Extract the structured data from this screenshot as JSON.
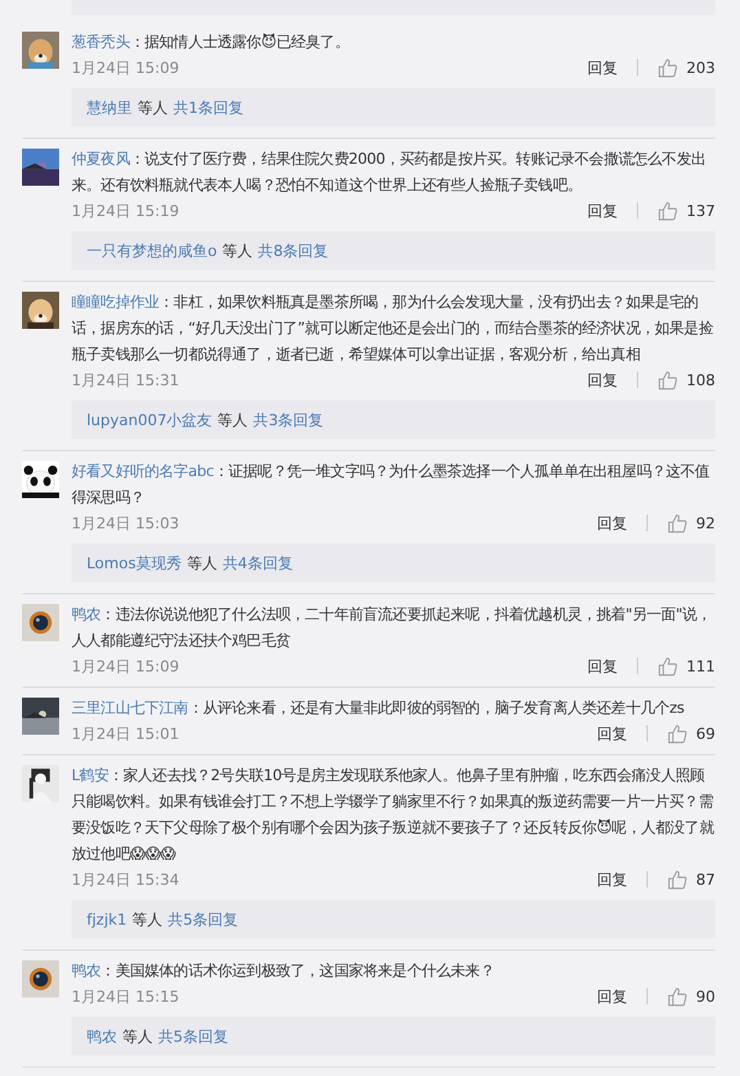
{
  "comments": [
    {
      "user": "葱香秃头",
      "colon": "：",
      "text": "据知情人士透露你😈已经臭了。",
      "time": "1月24日 15:09",
      "reply": "回复",
      "likes": "203",
      "thread": {
        "users": "慧纳里",
        "suffix": "等人",
        "count": "共1条回复"
      }
    },
    {
      "user": "仲夏夜风",
      "colon": "：",
      "text": "说支付了医疗费，结果住院欠费2000，买药都是按片买。转账记录不会撒谎怎么不发出来。还有饮料瓶就代表本人喝？恐怕不知道这个世界上还有些人捡瓶子卖钱吧。",
      "time": "1月24日 15:19",
      "reply": "回复",
      "likes": "137",
      "thread": {
        "users": "一只有梦想的咸鱼o",
        "suffix": "等人",
        "count": "共8条回复"
      }
    },
    {
      "user": "瞳瞳吃掉作业",
      "colon": "：",
      "text": "非杠，如果饮料瓶真是墨茶所喝，那为什么会发现大量，没有扔出去？如果是宅的话，据房东的话，“好几天没出门了”就可以断定他还是会出门的，而结合墨茶的经济状况，如果是捡瓶子卖钱那么一切都说得通了，逝者已逝，希望媒体可以拿出证据，客观分析，给出真相",
      "time": "1月24日 15:31",
      "reply": "回复",
      "likes": "108",
      "thread": {
        "users": "lupyan007小盆友",
        "suffix": "等人",
        "count": "共3条回复"
      }
    },
    {
      "user": "好看又好听的名字abc",
      "colon": "：",
      "text": "证据呢？凭一堆文字吗？为什么墨茶选择一个人孤单单在出租屋吗？这不值得深思吗？",
      "time": "1月24日 15:03",
      "reply": "回复",
      "likes": "92",
      "thread": {
        "users": "Lomos莫现秀",
        "suffix": "等人",
        "count": "共4条回复"
      }
    },
    {
      "user": "鸭农",
      "colon": "：",
      "text": "违法你说说他犯了什么法呗，二十年前盲流还要抓起来呢，抖着优越机灵，挑着\"另一面\"说，人人都能遵纪守法还扶个鸡巴毛贫",
      "time": "1月24日 15:09",
      "reply": "回复",
      "likes": "111"
    },
    {
      "user": "三里江山七下江南",
      "colon": "：",
      "text": "从评论来看，还是有大量非此即彼的弱智的，脑子发育离人类还差十几个zs",
      "time": "1月24日 15:01",
      "reply": "回复",
      "likes": "69"
    },
    {
      "user": "L鹤安",
      "colon": "：",
      "text": "家人还去找？2号失联10号是房主发现联系他家人。他鼻子里有肿瘤，吃东西会痛没人照顾只能喝饮料。如果有钱谁会打工？不想上学辍学了躺家里不行？如果真的叛逆药需要一片一片买？需要没饭吃？天下父母除了极个别有哪个会因为孩子叛逆就不要孩子了？还反转反你😈呢，人都没了就放过他吧😱😱😱",
      "time": "1月24日 15:34",
      "reply": "回复",
      "likes": "87",
      "thread": {
        "users": "fjzjk1",
        "suffix": "等人",
        "count": "共5条回复"
      }
    },
    {
      "user": "鸭农",
      "colon": "：",
      "text": "美国媒体的话术你运到极致了，这国家将来是个什么未来？",
      "time": "1月24日 15:15",
      "reply": "回复",
      "likes": "90",
      "thread": {
        "users": "鸭农",
        "suffix": "等人",
        "count": "共5条回复"
      }
    }
  ]
}
